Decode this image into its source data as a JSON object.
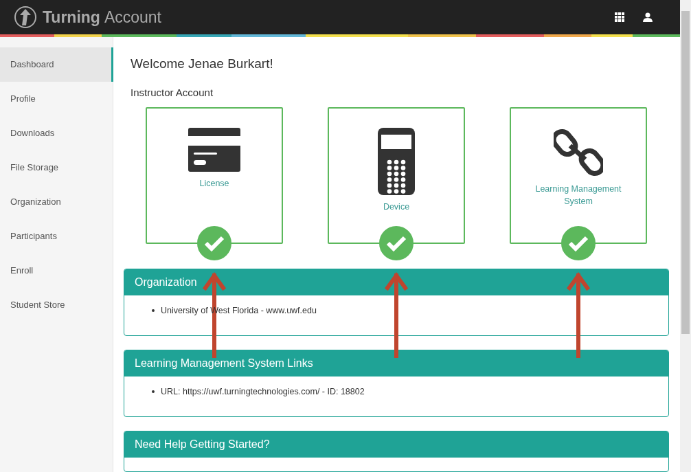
{
  "header": {
    "brand_bold": "Turning",
    "brand_light": "Account"
  },
  "sidebar": {
    "items": [
      {
        "label": "Dashboard",
        "selected": true
      },
      {
        "label": "Profile",
        "selected": false
      },
      {
        "label": "Downloads",
        "selected": false
      },
      {
        "label": "File Storage",
        "selected": false
      },
      {
        "label": "Organization",
        "selected": false
      },
      {
        "label": "Participants",
        "selected": false
      },
      {
        "label": "Enroll",
        "selected": false
      },
      {
        "label": "Student Store",
        "selected": false
      }
    ]
  },
  "welcome": "Welcome Jenae Burkart!",
  "account_type": "Instructor Account",
  "cards": [
    {
      "kind": "card",
      "label": "License",
      "checked": true
    },
    {
      "kind": "device",
      "label": "Device",
      "checked": true
    },
    {
      "kind": "link",
      "label": "Learning Management System",
      "checked": true
    }
  ],
  "panels": [
    {
      "title": "Organization",
      "items": [
        "University of West Florida - www.uwf.edu"
      ]
    },
    {
      "title": "Learning Management System Links",
      "items": [
        "URL: https://uwf.turningtechnologies.com/ - ID: 18802"
      ]
    },
    {
      "title": "Need Help Getting Started?"
    }
  ]
}
